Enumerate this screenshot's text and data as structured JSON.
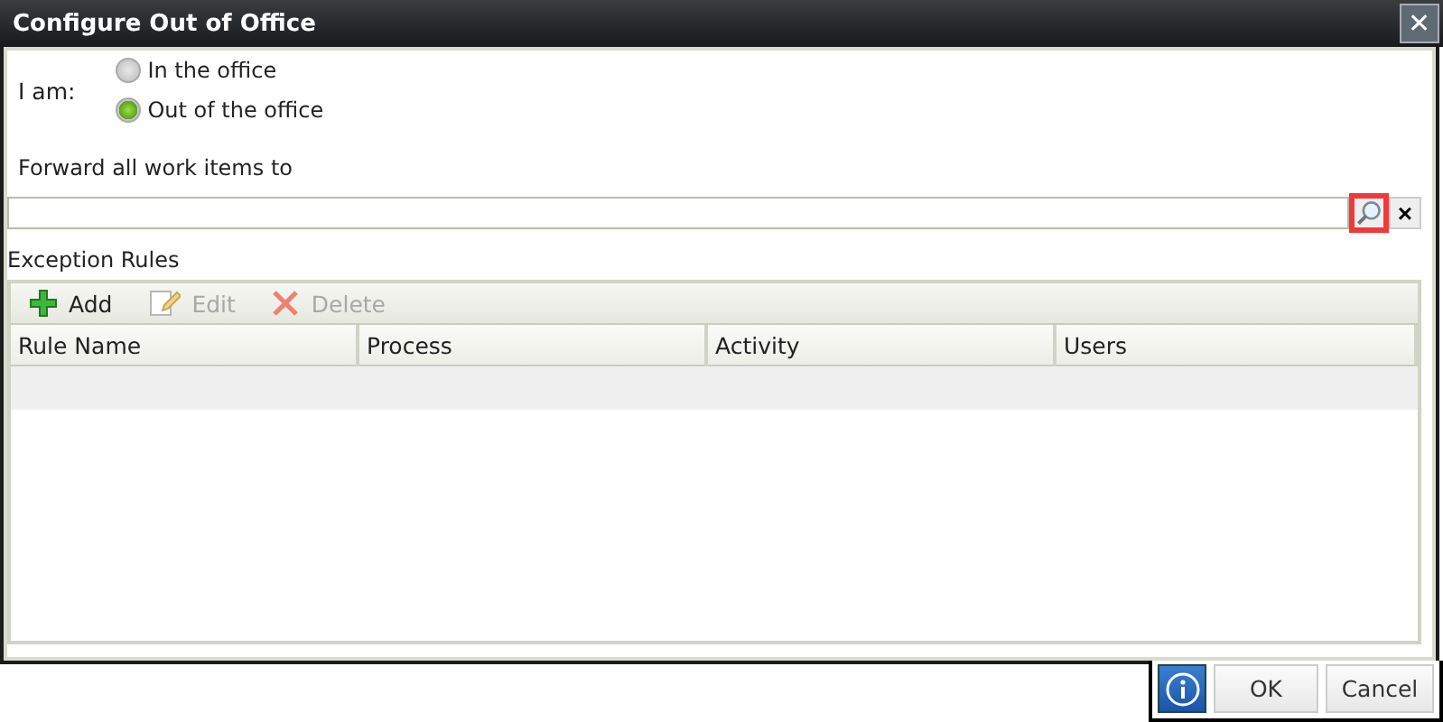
{
  "window": {
    "title": "Configure Out of Office",
    "close": "✕"
  },
  "status": {
    "label": "I am:",
    "options": [
      {
        "label": "In the office",
        "selected": false
      },
      {
        "label": "Out of the office",
        "selected": true
      }
    ]
  },
  "forward": {
    "label": "Forward all work items to",
    "search_highlighted": true,
    "clear": "×"
  },
  "exceptions": {
    "label": "Exception Rules",
    "toolbar": [
      {
        "kind": "add",
        "label": "Add",
        "disabled": false
      },
      {
        "kind": "edit",
        "label": "Edit",
        "disabled": true
      },
      {
        "kind": "delete",
        "label": "Delete",
        "disabled": true
      }
    ],
    "columns": [
      "Rule Name",
      "Process",
      "Activity",
      "Users"
    ]
  },
  "buttons": [
    {
      "kind": "info"
    },
    {
      "kind": "text",
      "label": "OK"
    },
    {
      "kind": "text",
      "label": "Cancel"
    }
  ]
}
